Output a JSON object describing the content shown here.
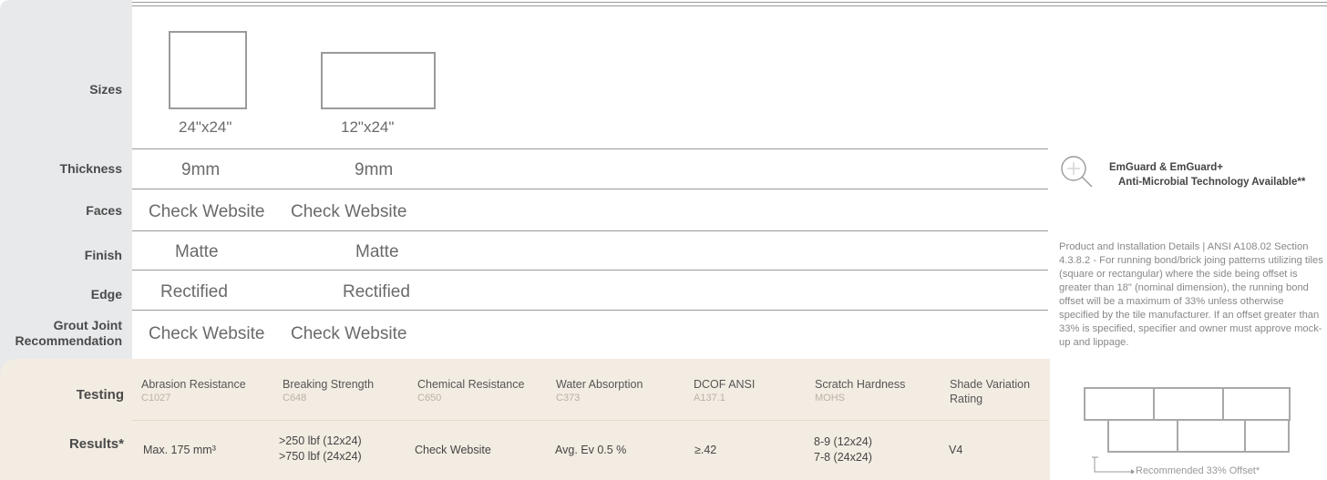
{
  "rows": {
    "sizes": "Sizes",
    "thickness": "Thickness",
    "faces": "Faces",
    "finish": "Finish",
    "edge": "Edge",
    "grout_line1": "Grout Joint",
    "grout_line2": "Recommendation"
  },
  "sizes": [
    {
      "caption": "24\"x24\"",
      "thickness": "9mm",
      "faces": "Check Website",
      "finish": "Matte",
      "edge": "Rectified",
      "grout": "Check Website"
    },
    {
      "caption": "12\"x24\"",
      "thickness": "9mm",
      "faces": "Check Website",
      "finish": "Matte",
      "edge": "Rectified",
      "grout": "Check Website"
    }
  ],
  "testing": {
    "label": "Testing",
    "results_label": "Results*",
    "columns": [
      {
        "name": "Abrasion Resistance",
        "code": "C1027",
        "result1": "Max. 175 mm³",
        "result2": ""
      },
      {
        "name": "Breaking Strength",
        "code": "C648",
        "result1": ">250 lbf (12x24)",
        "result2": ">750 lbf (24x24)"
      },
      {
        "name": "Chemical Resistance",
        "code": "C650",
        "result1": "Check Website",
        "result2": ""
      },
      {
        "name": "Water Absorption",
        "code": "C373",
        "result1": "Avg. Ev 0.5 %",
        "result2": ""
      },
      {
        "name": "DCOF ANSI",
        "code": "A137.1",
        "result1": "≥.42",
        "result2": ""
      },
      {
        "name": "Scratch Hardness",
        "code": "MOHS",
        "result1": "8-9 (12x24)",
        "result2": "7-8 (24x24)"
      },
      {
        "name": "Shade Variation",
        "code": "Rating",
        "result1": "V4",
        "result2": ""
      }
    ]
  },
  "sidebar": {
    "emguard_line1": "EmGuard & EmGuard+",
    "emguard_line2": "Anti-Microbial Technology Available**",
    "details": "Product and Installation Details | ANSI A108.02 Section 4.3.8.2 - For running bond/brick joing patterns utilizing tiles (square or rectangular) where the side being offset is greater than 18\" (nominal dimension), the running bond offset will be a maximum of 33% unless otherwise specified by the tile manufacturer. If an offset greater than 33% is specified, specifier and owner must approve mock-up and lippage.",
    "offset_caption": "Recommended 33% Offset*"
  },
  "colors": {
    "label_bg": "#e8e9eb",
    "testing_bg": "#f3ece2",
    "line": "#9a9a9a"
  }
}
